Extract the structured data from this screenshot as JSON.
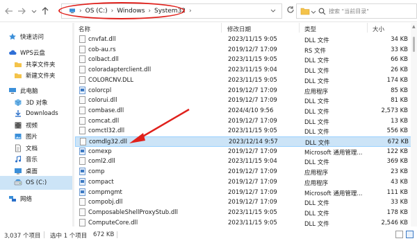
{
  "address_bar": {
    "back_icon": "arrow-left",
    "forward_icon": "arrow-right",
    "recent_icon": "chevron-down",
    "up_icon": "arrow-up",
    "crumbs": [
      "OS (C:)",
      "Windows",
      "System32"
    ],
    "crumb_separator": "›",
    "search_placeholder": "搜索 \"当前目录\""
  },
  "sidebar": {
    "items": [
      {
        "label": "快速访问",
        "icon": "star-icon"
      },
      {
        "label": "WPS云盘",
        "icon": "cloud-icon"
      },
      {
        "label": "共享文件夹",
        "icon": "folder-icon"
      },
      {
        "label": "新建文件夹",
        "icon": "folder-icon"
      },
      {
        "label": "此电脑",
        "icon": "computer-icon"
      },
      {
        "label": "3D 对象",
        "icon": "cube-icon"
      },
      {
        "label": "Downloads",
        "icon": "download-icon"
      },
      {
        "label": "视频",
        "icon": "video-icon"
      },
      {
        "label": "图片",
        "icon": "picture-icon"
      },
      {
        "label": "文档",
        "icon": "document-icon"
      },
      {
        "label": "音乐",
        "icon": "music-icon"
      },
      {
        "label": "桌面",
        "icon": "desktop-icon"
      },
      {
        "label": "OS (C:)",
        "icon": "drive-icon"
      },
      {
        "label": "网络",
        "icon": "network-icon"
      }
    ],
    "selected_index": 12
  },
  "columns": {
    "name": "名称",
    "date": "修改日期",
    "type": "类型",
    "size": "大小"
  },
  "files": [
    {
      "name": "cnvfat.dll",
      "date": "2023/11/15 9:05",
      "type": "DLL 文件",
      "size": "34 KB",
      "icon": "dll-file-icon"
    },
    {
      "name": "cob-au.rs",
      "date": "2019/12/7 17:09",
      "type": "RS 文件",
      "size": "33 KB",
      "icon": "file-icon"
    },
    {
      "name": "colbact.dll",
      "date": "2023/11/15 9:05",
      "type": "DLL 文件",
      "size": "66 KB",
      "icon": "dll-file-icon"
    },
    {
      "name": "coloradapterclient.dll",
      "date": "2023/11/15 9:04",
      "type": "DLL 文件",
      "size": "26 KB",
      "icon": "dll-file-icon"
    },
    {
      "name": "COLORCNV.DLL",
      "date": "2023/11/15 9:05",
      "type": "DLL 文件",
      "size": "174 KB",
      "icon": "dll-file-icon"
    },
    {
      "name": "colorcpl",
      "date": "2019/12/7 17:09",
      "type": "应用程序",
      "size": "85 KB",
      "icon": "app-icon"
    },
    {
      "name": "colorui.dll",
      "date": "2019/12/7 17:09",
      "type": "DLL 文件",
      "size": "81 KB",
      "icon": "dll-file-icon"
    },
    {
      "name": "combase.dll",
      "date": "2024/4/10 9:56",
      "type": "DLL 文件",
      "size": "2,573 KB",
      "icon": "dll-file-icon"
    },
    {
      "name": "comcat.dll",
      "date": "2019/12/7 17:09",
      "type": "DLL 文件",
      "size": "13 KB",
      "icon": "dll-file-icon"
    },
    {
      "name": "comctl32.dll",
      "date": "2023/11/15 9:05",
      "type": "DLL 文件",
      "size": "556 KB",
      "icon": "dll-file-icon"
    },
    {
      "name": "comdlg32.dll",
      "date": "2023/12/14 9:57",
      "type": "DLL 文件",
      "size": "672 KB",
      "icon": "dll-file-icon"
    },
    {
      "name": "comexp",
      "date": "2019/12/7 17:09",
      "type": "Microsoft 通用管理...",
      "size": "122 KB",
      "icon": "app-icon"
    },
    {
      "name": "coml2.dll",
      "date": "2023/11/15 9:04",
      "type": "DLL 文件",
      "size": "369 KB",
      "icon": "dll-file-icon"
    },
    {
      "name": "comp",
      "date": "2019/12/7 17:09",
      "type": "应用程序",
      "size": "23 KB",
      "icon": "app-icon"
    },
    {
      "name": "compact",
      "date": "2019/12/7 17:09",
      "type": "应用程序",
      "size": "43 KB",
      "icon": "app-icon"
    },
    {
      "name": "compmgmt",
      "date": "2019/12/7 17:09",
      "type": "Microsoft 通用管理...",
      "size": "111 KB",
      "icon": "app-icon"
    },
    {
      "name": "compobj.dll",
      "date": "2019/12/7 17:09",
      "type": "DLL 文件",
      "size": "33 KB",
      "icon": "dll-file-icon"
    },
    {
      "name": "ComposableShellProxyStub.dll",
      "date": "2023/11/15 9:05",
      "type": "DLL 文件",
      "size": "178 KB",
      "icon": "dll-file-icon"
    },
    {
      "name": "ComputeCore.dll",
      "date": "2023/11/15 9:05",
      "type": "DLL 文件",
      "size": "2,546 KB",
      "icon": "dll-file-icon"
    }
  ],
  "selected_file_index": 10,
  "status": {
    "item_count": "3,037 个项目",
    "selection": "选中 1 个项目",
    "selection_size": "672 KB"
  },
  "annotation_color": "#e0211c",
  "selection_color": "#cce4f7"
}
